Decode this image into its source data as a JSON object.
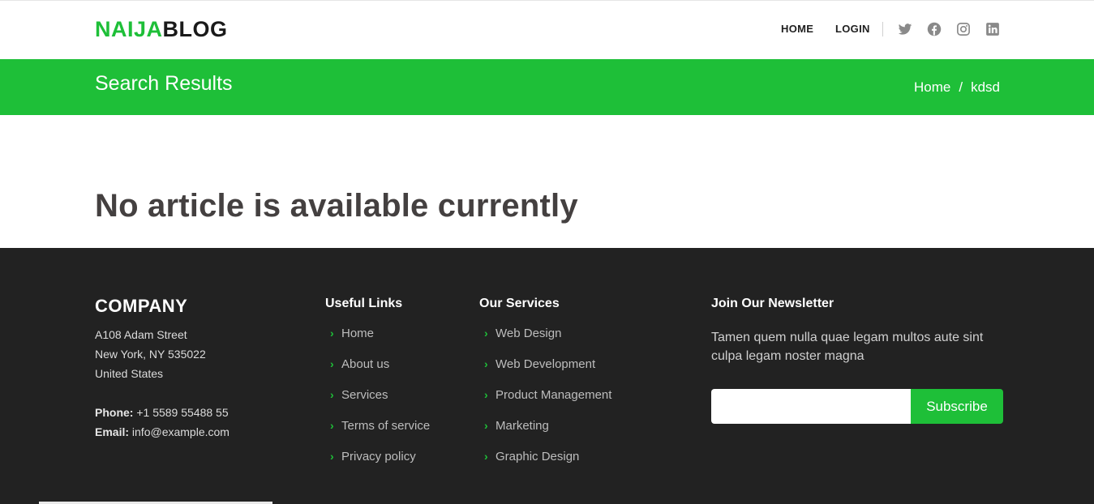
{
  "header": {
    "logo_part1": "NAIJA",
    "logo_part2": "BLOG",
    "nav": {
      "home": "HOME",
      "login": "LOGIN"
    },
    "social_icons": [
      "twitter-icon",
      "facebook-icon",
      "instagram-icon",
      "linkedin-icon"
    ]
  },
  "band": {
    "title": "Search Results",
    "breadcrumb": {
      "home": "Home",
      "separator": "/",
      "current": "kdsd"
    }
  },
  "main": {
    "message": "No article is available currently"
  },
  "footer": {
    "company": {
      "title": "COMPANY",
      "address_line1": "A108 Adam Street",
      "address_line2": "New York, NY 535022",
      "address_line3": "United States",
      "phone_label": "Phone:",
      "phone": "+1 5589 55488 55",
      "email_label": "Email:",
      "email": "info@example.com"
    },
    "useful_links": {
      "title": "Useful Links",
      "items": [
        "Home",
        "About us",
        "Services",
        "Terms of service",
        "Privacy policy"
      ]
    },
    "services": {
      "title": "Our Services",
      "items": [
        "Web Design",
        "Web Development",
        "Product Management",
        "Marketing",
        "Graphic Design"
      ]
    },
    "newsletter": {
      "title": "Join Our Newsletter",
      "text": "Tamen quem nulla quae legam multos aute sint culpa legam noster magna",
      "input_value": "",
      "button": "Subscribe"
    }
  },
  "colors": {
    "accent": "#1ebf38",
    "footer_bg": "#222222",
    "heading": "#444040"
  }
}
